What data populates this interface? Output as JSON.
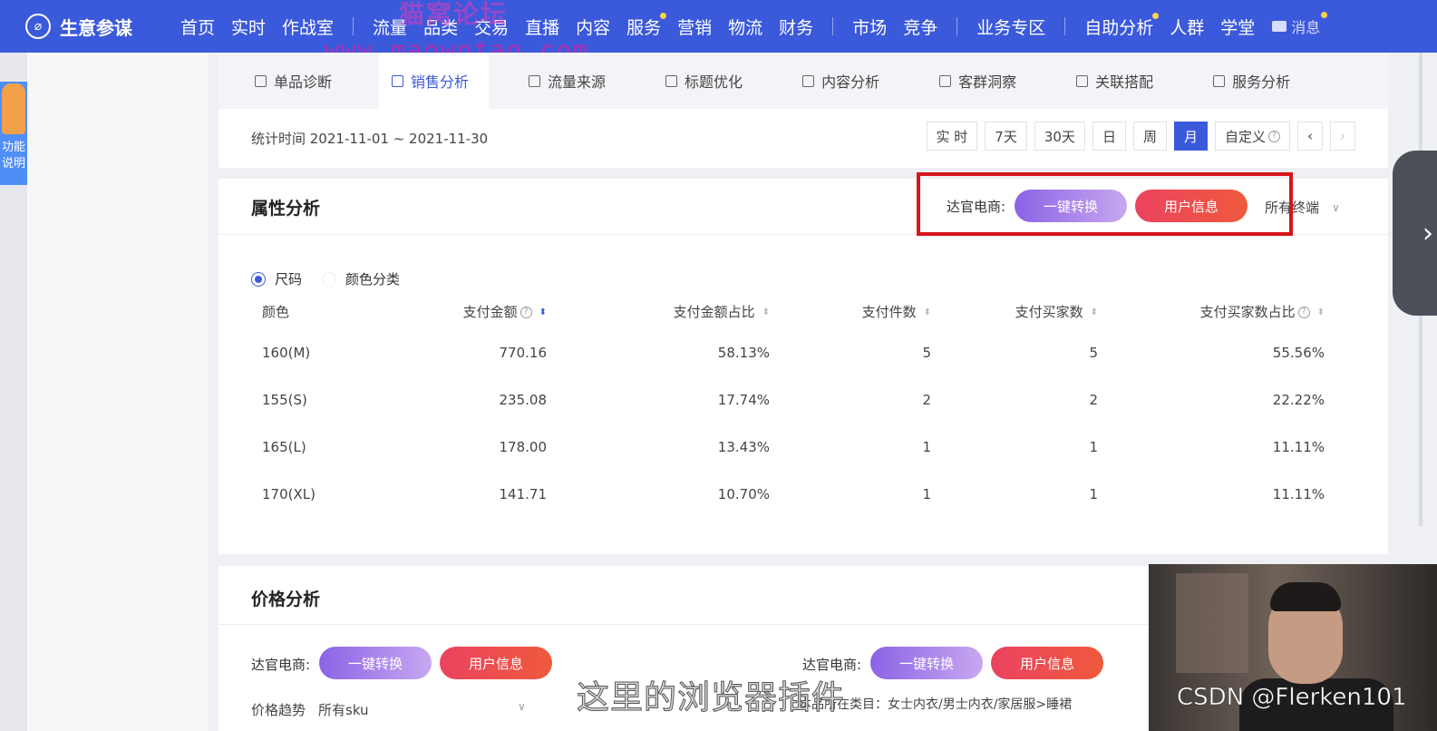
{
  "topnav": {
    "brand": "生意参谋",
    "items_a": [
      "首页",
      "实时",
      "作战室"
    ],
    "items_b": [
      "流量",
      "品类",
      "交易",
      "直播",
      "内容",
      "服务",
      "营销",
      "物流",
      "财务"
    ],
    "items_c": [
      "市场",
      "竞争"
    ],
    "items_d": [
      "业务专区"
    ],
    "items_e": [
      "自助分析",
      "人群",
      "学堂"
    ],
    "message": "消息"
  },
  "watermark": {
    "line1": "猫窝论坛",
    "line2": "www.maowotao.com"
  },
  "left_help": "功能说明",
  "tabs": [
    "单品诊断",
    "销售分析",
    "流量来源",
    "标题优化",
    "内容分析",
    "客群洞察",
    "关联搭配",
    "服务分析"
  ],
  "active_tab": "销售分析",
  "time_range_label": "统计时间 2021-11-01 ~ 2021-11-30",
  "time_buttons": [
    "实 时",
    "7天",
    "30天",
    "日",
    "周",
    "月",
    "自定义"
  ],
  "attr_section": {
    "title": "属性分析",
    "ext_label": "达官电商:",
    "btn_convert": "一键转换",
    "btn_userinfo": "用户信息",
    "terminal": "所有终端",
    "radio_size": "尺码",
    "radio_color": "颜色分类",
    "columns": [
      "颜色",
      "支付金额",
      "支付金额占比",
      "支付件数",
      "支付买家数",
      "支付买家数占比"
    ],
    "rows": [
      [
        "160(M)",
        "770.16",
        "58.13%",
        "5",
        "5",
        "55.56%"
      ],
      [
        "155(S)",
        "235.08",
        "17.74%",
        "2",
        "2",
        "22.22%"
      ],
      [
        "165(L)",
        "178.00",
        "13.43%",
        "1",
        "1",
        "11.11%"
      ],
      [
        "170(XL)",
        "141.71",
        "10.70%",
        "1",
        "1",
        "11.11%"
      ]
    ]
  },
  "price_section": {
    "title": "价格分析",
    "ext_label_left": "达官电商:",
    "ext_label_right": "达官电商:",
    "btn_convert": "一键转换",
    "btn_userinfo": "用户信息",
    "trend_label": "价格趋势",
    "trend_value": "所有sku",
    "category_text": "本品所在类目：女士内衣/男士内衣/家居服>睡裙"
  },
  "subtitle": "这里的浏览器插件",
  "credit": "CSDN @Flerken101",
  "colors": {
    "nav_blue": "#3b59db",
    "highlight_red": "#d8141c",
    "pill_purple": "#8c63e6",
    "pill_red": "#ec4260"
  }
}
